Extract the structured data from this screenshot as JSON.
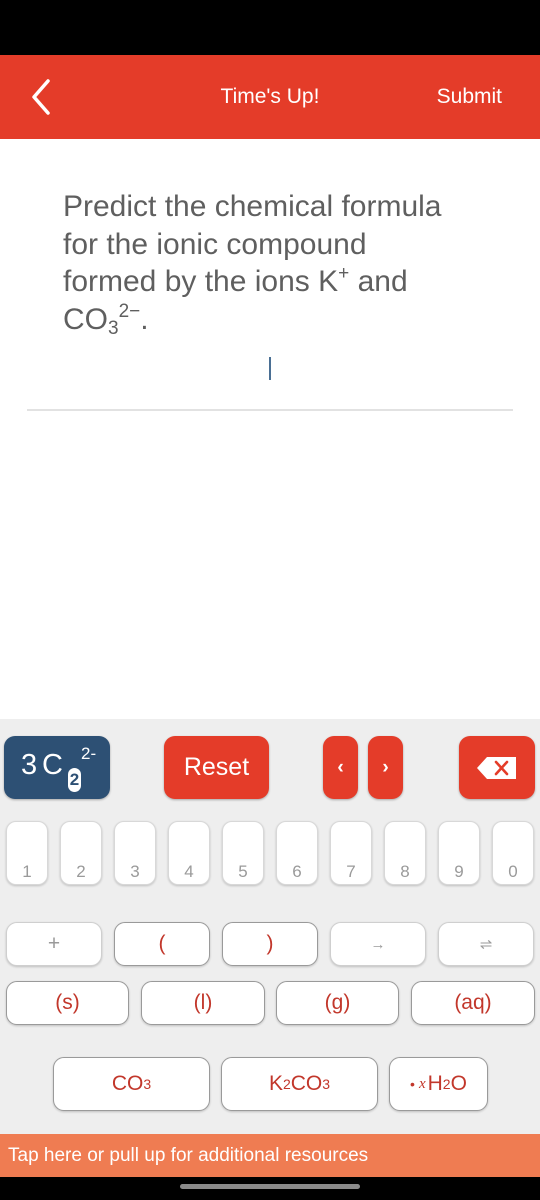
{
  "app_bar": {
    "back_icon": "chevron-left-icon",
    "title": "Time's Up!",
    "submit_label": "Submit",
    "color": "#e43c29"
  },
  "question": {
    "line1": "Predict the chemical formula",
    "line2": "for the ionic compound",
    "line3_prefix": "formed by the ions K",
    "line3_cation_charge": "+",
    "line3_suffix": " and",
    "anion_base": "CO",
    "anion_subscript": "3",
    "anion_charge": "2−",
    "end_punct": "."
  },
  "answer": {
    "value": "",
    "cursor_visible": true
  },
  "keypad": {
    "preview": {
      "coefficient": "3",
      "element": "C",
      "active_subscript": "2",
      "charge": "2-",
      "color": "#2d5074"
    },
    "reset_label": "Reset",
    "cursor_left_label": "‹",
    "cursor_right_label": "›",
    "delete_icon": "backspace-icon",
    "digits": [
      "1",
      "2",
      "3",
      "4",
      "5",
      "6",
      "7",
      "8",
      "9",
      "0"
    ],
    "row2": {
      "plus": "+",
      "open_paren": "(",
      "close_paren": ")",
      "arrow": "→",
      "equilibrium": "⇌"
    },
    "states": [
      "(s)",
      "(l)",
      "(g)",
      "(aq)"
    ],
    "species": {
      "co3_base": "CO",
      "co3_sub": "3",
      "k2co3_k": "K",
      "k2co3_ksub": "2",
      "k2co3_co": "CO",
      "k2co3_cosub": "3",
      "hydrate_dot": "•",
      "hydrate_x": "x",
      "hydrate_h": "H",
      "hydrate_hsub": "2",
      "hydrate_o": "O"
    }
  },
  "resources_bar": {
    "label": "Tap here or pull up for additional resources",
    "color": "#ef7c52"
  }
}
